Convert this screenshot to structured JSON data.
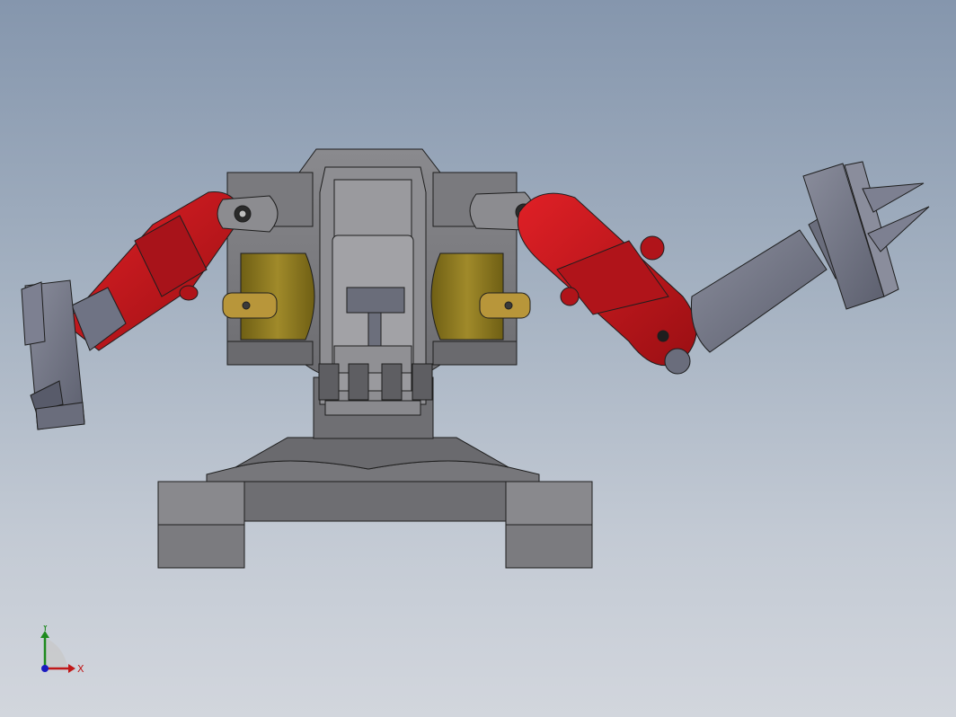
{
  "viewport": {
    "background_top": "#8596ad",
    "background_bottom": "#d2d6dd"
  },
  "model": {
    "colors": {
      "body_gray": "#7c7c80",
      "body_dark": "#5a5a5e",
      "arm_red": "#c4161c",
      "arm_red_dark": "#8a0d10",
      "bushing_olive": "#8c7a1e",
      "bushing_tan": "#b8963a",
      "gripper_blue_gray": "#6f7384",
      "edge": "#1e1e1e"
    }
  },
  "triad": {
    "x_label": "X",
    "y_label": "Y",
    "x_color": "#c01818",
    "y_color": "#1e8a1e",
    "z_color": "#1a1ac0"
  }
}
